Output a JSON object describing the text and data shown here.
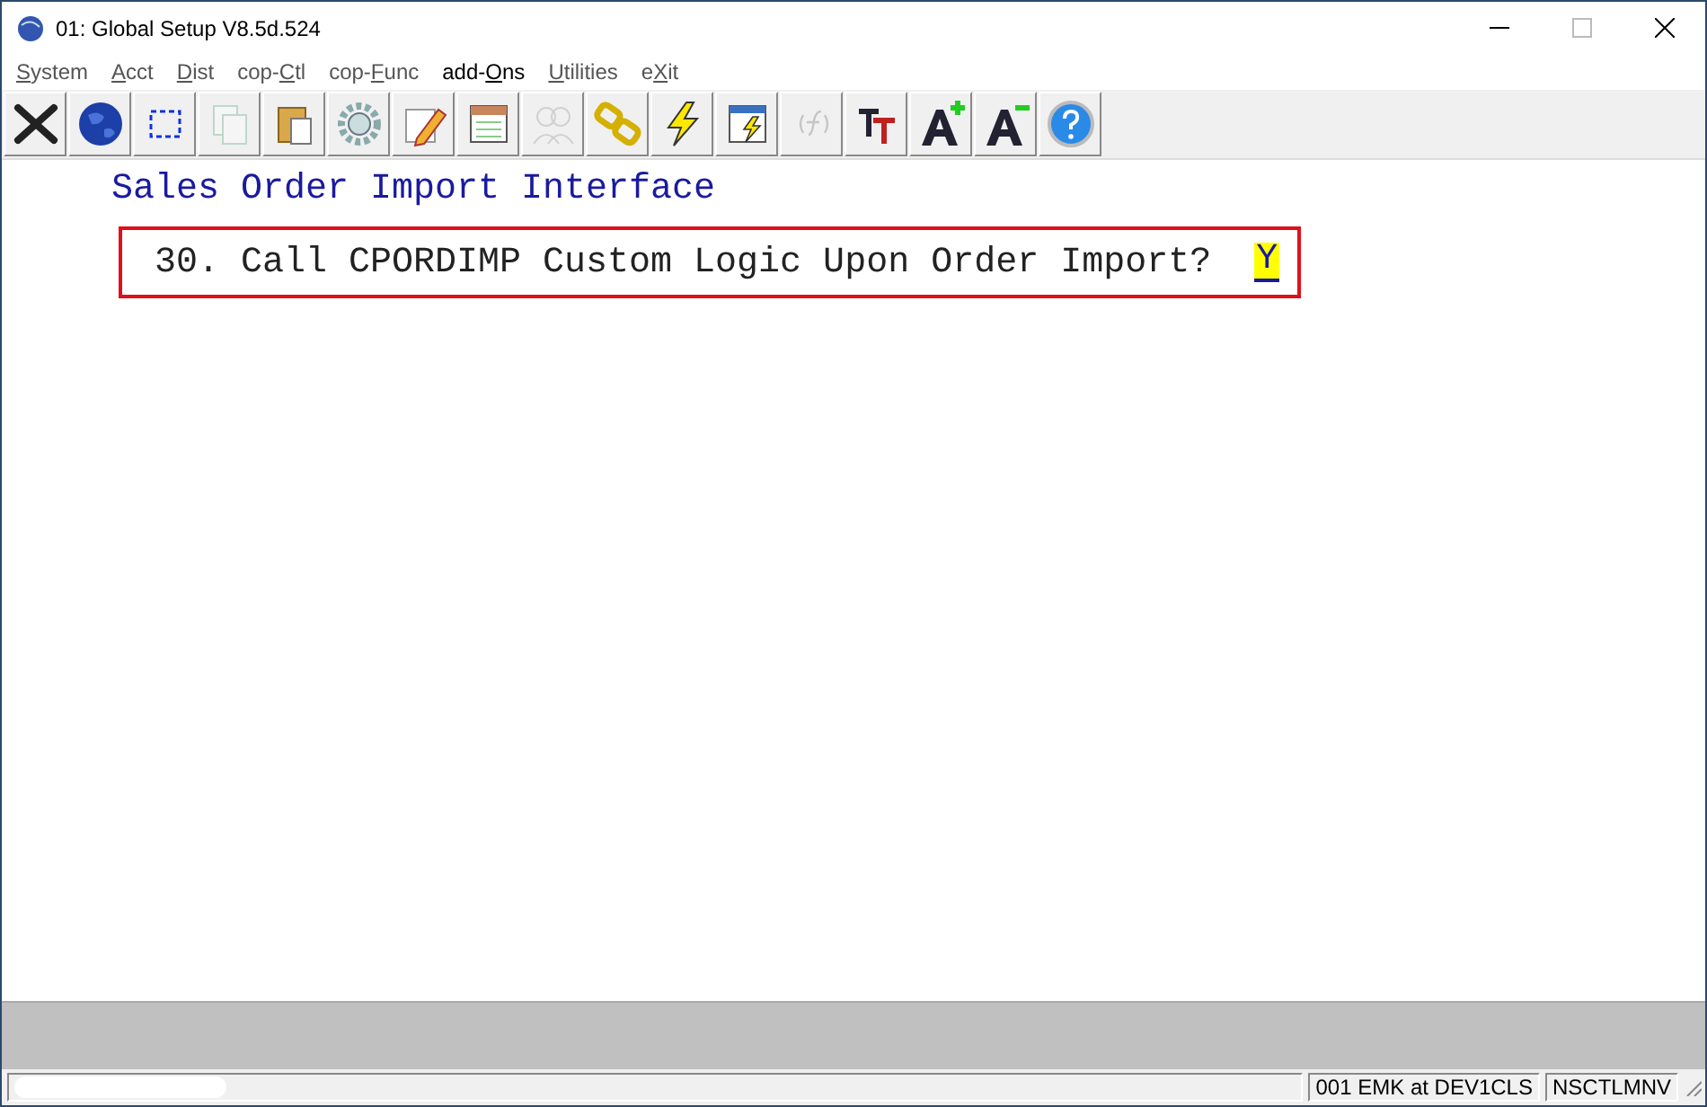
{
  "window": {
    "title": "01: Global Setup V8.5d.524"
  },
  "menu": [
    {
      "key": "S",
      "post": "ystem",
      "active": false
    },
    {
      "key": "A",
      "post": "cct",
      "active": false
    },
    {
      "key": "D",
      "post": "ist",
      "active": false
    },
    {
      "pre": "cop-",
      "key": "C",
      "post": "tl",
      "active": false
    },
    {
      "pre": "cop-",
      "key": "F",
      "post": "unc",
      "active": false
    },
    {
      "pre": "add-",
      "key": "O",
      "post": "ns",
      "active": true
    },
    {
      "key": "U",
      "post": "tilities",
      "active": false
    },
    {
      "pre": "e",
      "key": "X",
      "post": "it",
      "active": false
    }
  ],
  "toolbar": [
    {
      "kind": "close",
      "disabled": false
    },
    {
      "kind": "globe",
      "disabled": false
    },
    {
      "kind": "select",
      "disabled": false
    },
    {
      "kind": "copy",
      "disabled": true
    },
    {
      "kind": "paste",
      "disabled": false
    },
    {
      "kind": "gear",
      "disabled": false
    },
    {
      "kind": "edit",
      "disabled": false
    },
    {
      "kind": "window",
      "disabled": false
    },
    {
      "kind": "users",
      "disabled": true
    },
    {
      "kind": "link",
      "disabled": false
    },
    {
      "kind": "bolt",
      "disabled": false
    },
    {
      "kind": "run",
      "disabled": false
    },
    {
      "kind": "function",
      "disabled": true
    },
    {
      "kind": "font",
      "disabled": false
    },
    {
      "kind": "grow",
      "disabled": false
    },
    {
      "kind": "shrink",
      "disabled": false
    },
    {
      "kind": "help",
      "disabled": false
    }
  ],
  "screen": {
    "heading": "Sales Order Import Interface",
    "fields": [
      {
        "prompt": "30. Call CPORDIMP Custom Logic Upon Order Import?",
        "value": "Y",
        "highlighted": true
      }
    ]
  },
  "status_bar": {
    "panes": [
      "001 EMK at DEV1CLS",
      "NSCTLMNV"
    ]
  }
}
